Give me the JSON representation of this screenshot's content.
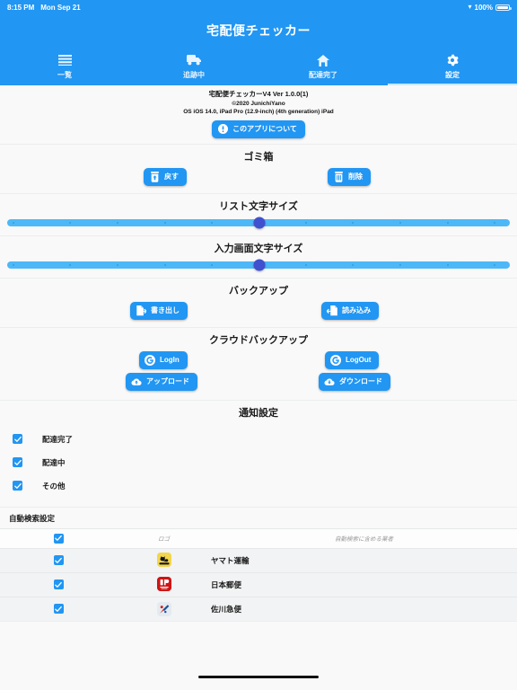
{
  "status_bar": {
    "time": "8:15 PM",
    "date": "Mon Sep 21",
    "wifi_icon": "wifi-icon",
    "battery_text": "100%",
    "battery_icon": "battery-full-icon"
  },
  "header": {
    "title": "宅配便チェッカー",
    "tabs": [
      {
        "label": "一覧",
        "icon": "list-icon",
        "active": false
      },
      {
        "label": "追跡中",
        "icon": "truck-icon",
        "active": false
      },
      {
        "label": "配達完了",
        "icon": "home-icon",
        "active": false
      },
      {
        "label": "設定",
        "icon": "gear-icon",
        "active": true
      }
    ]
  },
  "about": {
    "line1": "宅配便チェッカーV4 Ver 1.0.0(1)",
    "line2": "©2020 JunichiYano",
    "line3": "OS  iOS 14.0, iPad Pro (12.9-inch) (4th generation) iPad",
    "button_label": "このアプリについて",
    "button_icon": "info-icon"
  },
  "trash": {
    "title": "ゴミ箱",
    "restore_label": "戻す",
    "restore_icon": "restore-trash-icon",
    "delete_label": "削除",
    "delete_icon": "trash-icon"
  },
  "list_font_size": {
    "title": "リスト文字サイズ",
    "value": 50,
    "min": 0,
    "max": 100,
    "ticks": 9
  },
  "input_font_size": {
    "title": "入力画面文字サイズ",
    "value": 50,
    "min": 0,
    "max": 100,
    "ticks": 9
  },
  "backup": {
    "title": "バックアップ",
    "export_label": "書き出し",
    "export_icon": "file-export-icon",
    "import_label": "読み込み",
    "import_icon": "file-import-icon"
  },
  "cloud_backup": {
    "title": "クラウドバックアップ",
    "login_label": "LogIn",
    "login_icon": "google-g-icon",
    "logout_label": "LogOut",
    "logout_icon": "google-g-icon",
    "upload_label": "アップロード",
    "upload_icon": "cloud-upload-icon",
    "download_label": "ダウンロード",
    "download_icon": "cloud-download-icon"
  },
  "notifications": {
    "title": "通知設定",
    "items": [
      {
        "label": "配達完了",
        "checked": true
      },
      {
        "label": "配達中",
        "checked": true
      },
      {
        "label": "その他",
        "checked": true
      }
    ]
  },
  "auto_search": {
    "title": "自動検索設定",
    "col_logo": "ロゴ",
    "col_carrier": "自動検索に含める業者",
    "header_checked": true,
    "rows": [
      {
        "checked": true,
        "logo": "yamato-logo",
        "name": "ヤマト運輸"
      },
      {
        "checked": true,
        "logo": "japanpost-logo",
        "name": "日本郵便"
      },
      {
        "checked": true,
        "logo": "sagawa-logo",
        "name": "佐川急便"
      }
    ]
  },
  "colors": {
    "accent": "#2196f3",
    "slider_track": "#4db8f7",
    "slider_knob": "#3f51cf",
    "background": "#f9f9f9",
    "row_alt": "#f2f3f4"
  },
  "home_indicator": "home-indicator"
}
